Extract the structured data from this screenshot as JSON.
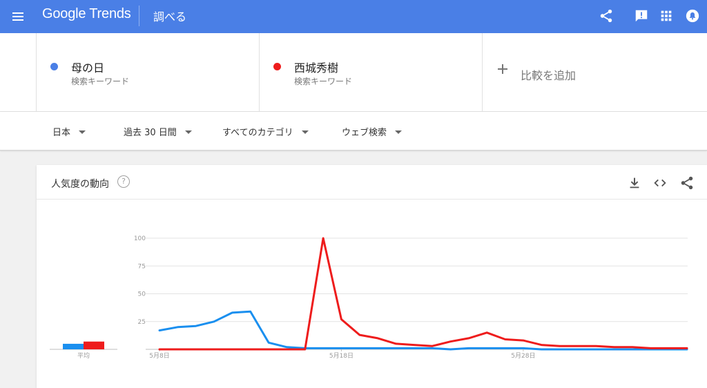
{
  "header": {
    "logo": "Google Trends",
    "page_title": "調べる"
  },
  "compare": {
    "terms": [
      {
        "name": "母の日",
        "subtitle": "検索キーワード",
        "color": "#4a7fe6"
      },
      {
        "name": "西城秀樹",
        "subtitle": "検索キーワード",
        "color": "#ee1c1c"
      }
    ],
    "add_label": "比較を追加"
  },
  "filters": {
    "region": "日本",
    "period": "過去 30 日間",
    "category": "すべてのカテゴリ",
    "search_type": "ウェブ検索"
  },
  "interest": {
    "title": "人気度の動向",
    "help": "?"
  },
  "chart_data": {
    "type": "line",
    "ylim": [
      0,
      100
    ],
    "yticks": [
      "100",
      "75",
      "50",
      "25"
    ],
    "x_tick_labels": [
      {
        "label": "5月8日",
        "index": 0
      },
      {
        "label": "5月18日",
        "index": 10
      },
      {
        "label": "5月28日",
        "index": 20
      }
    ],
    "avg_label": "平均",
    "averages": [
      5,
      7
    ],
    "series": [
      {
        "name": "母の日",
        "color": "#1a8fef",
        "values": [
          17,
          20,
          21,
          25,
          33,
          34,
          6,
          2,
          1,
          1,
          1,
          1,
          1,
          1,
          1,
          1,
          0,
          1,
          1,
          1,
          1,
          0,
          0,
          0,
          0,
          0,
          0,
          0,
          0,
          0
        ]
      },
      {
        "name": "西城秀樹",
        "color": "#ee1c1c",
        "values": [
          0,
          0,
          0,
          0,
          0,
          0,
          0,
          0,
          0,
          100,
          27,
          13,
          10,
          5,
          4,
          3,
          7,
          10,
          15,
          9,
          8,
          4,
          3,
          3,
          3,
          2,
          2,
          1,
          1,
          1
        ]
      }
    ]
  }
}
